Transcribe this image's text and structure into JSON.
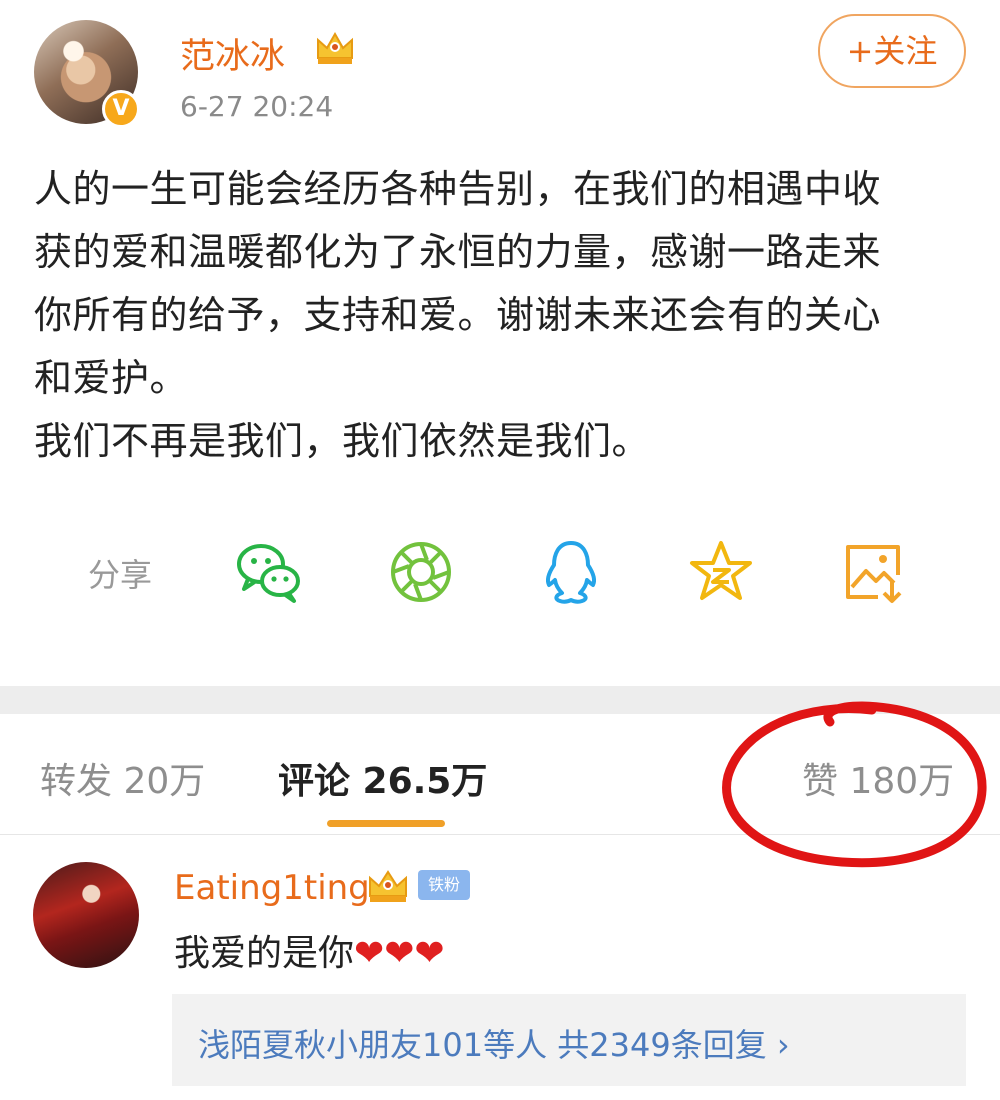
{
  "post": {
    "author": "范冰冰",
    "verify_mark": "V",
    "timestamp": "6-27 20:24",
    "follow_label": "+关注",
    "text": "人的一生可能会经历各种告别，在我们的相遇中收\n获的爱和温暖都化为了永恒的力量，感谢一路走来\n你所有的给予，支持和爱。谢谢未来还会有的关心\n和爱护。\n我们不再是我们，我们依然是我们。"
  },
  "share": {
    "label": "分享",
    "icons": [
      "wechat-icon",
      "moments-icon",
      "qq-icon",
      "qzone-icon",
      "save-image-icon"
    ]
  },
  "tabs": {
    "repost": "转发 20万",
    "comments": "评论 26.5万",
    "likes": "赞 180万"
  },
  "comment": {
    "author": "Eating1ting",
    "badge": "铁粉",
    "text": "我爱的是你❤❤❤",
    "replies": "浅陌夏秋小朋友101等人  共2349条回复  ›"
  },
  "colors": {
    "accent": "#e86b1b",
    "tab_underline": "#f0a028",
    "link": "#4c7bbd",
    "annotation_red": "#e01515"
  }
}
